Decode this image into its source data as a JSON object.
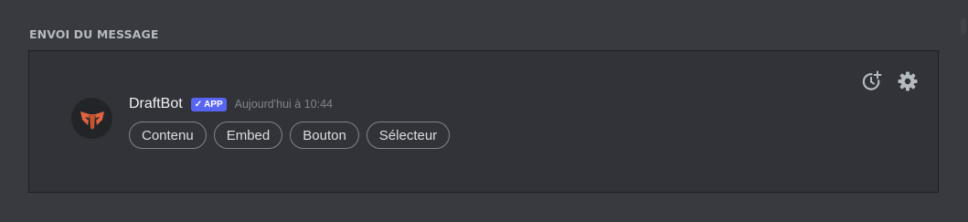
{
  "section": {
    "title": "ENVOI DU MESSAGE"
  },
  "message": {
    "username": "DraftBot",
    "badge_check": "✓",
    "badge_label": "APP",
    "timestamp": "Aujourd'hui à 10:44"
  },
  "buttons": [
    "Contenu",
    "Embed",
    "Bouton",
    "Sélecteur"
  ],
  "icons": {
    "schedule": "clock-add-icon",
    "settings": "gear-icon",
    "avatar": "draftbot-logo"
  },
  "colors": {
    "background": "#383a40",
    "panel": "#313338",
    "badge": "#5865f2",
    "logo": "#e0643f"
  }
}
